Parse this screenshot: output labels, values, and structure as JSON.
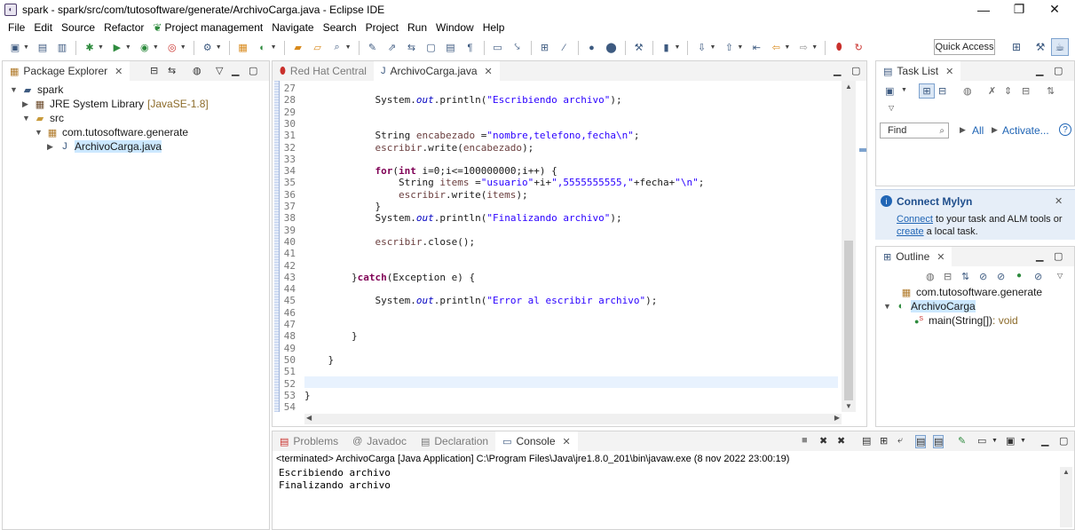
{
  "window": {
    "title": "spark - spark/src/com/tutosoftware/generate/ArchivoCarga.java - Eclipse IDE",
    "minimize": "—",
    "restore": "❐",
    "close": "✕"
  },
  "menu": [
    "File",
    "Edit",
    "Source",
    "Refactor",
    "Project management",
    "Navigate",
    "Search",
    "Project",
    "Run",
    "Window",
    "Help"
  ],
  "toolbar": {
    "quick_access": "Quick Access"
  },
  "package_explorer": {
    "tab_label": "Package Explorer",
    "tree": [
      {
        "label": "spark",
        "extra": ""
      },
      {
        "label": "JRE System Library",
        "extra": "[JavaSE-1.8]"
      },
      {
        "label": "src",
        "extra": ""
      },
      {
        "label": "com.tutosoftware.generate",
        "extra": ""
      },
      {
        "label": "ArchivoCarga.java",
        "extra": ""
      }
    ]
  },
  "editor": {
    "tabs": [
      {
        "label": "Red Hat Central"
      },
      {
        "label": "ArchivoCarga.java"
      }
    ],
    "lines": [
      {
        "n": "27",
        "code": ""
      },
      {
        "n": "28",
        "code": "            System.out.println(\"Escribiendo archivo\");"
      },
      {
        "n": "29",
        "code": ""
      },
      {
        "n": "30",
        "code": ""
      },
      {
        "n": "31",
        "code": "            String encabezado =\"nombre,telefono,fecha\\n\";"
      },
      {
        "n": "32",
        "code": "            escribir.write(encabezado);"
      },
      {
        "n": "33",
        "code": ""
      },
      {
        "n": "34",
        "code": "            for(int i=0;i<=100000000;i++) {"
      },
      {
        "n": "35",
        "code": "                String items =\"usuario\"+i+\",5555555555,\"+fecha+\"\\n\";"
      },
      {
        "n": "36",
        "code": "                escribir.write(items);"
      },
      {
        "n": "37",
        "code": "            }"
      },
      {
        "n": "38",
        "code": "            System.out.println(\"Finalizando archivo\");"
      },
      {
        "n": "39",
        "code": ""
      },
      {
        "n": "40",
        "code": "            escribir.close();"
      },
      {
        "n": "41",
        "code": ""
      },
      {
        "n": "42",
        "code": ""
      },
      {
        "n": "43",
        "code": "        }catch(Exception e) {"
      },
      {
        "n": "44",
        "code": ""
      },
      {
        "n": "45",
        "code": "            System.out.println(\"Error al escribir archivo\");"
      },
      {
        "n": "46",
        "code": ""
      },
      {
        "n": "47",
        "code": ""
      },
      {
        "n": "48",
        "code": "        }"
      },
      {
        "n": "49",
        "code": ""
      },
      {
        "n": "50",
        "code": "    }"
      },
      {
        "n": "51",
        "code": ""
      },
      {
        "n": "52",
        "code": ""
      },
      {
        "n": "53",
        "code": "}"
      },
      {
        "n": "54",
        "code": ""
      }
    ]
  },
  "task_list": {
    "tab_label": "Task List",
    "find_placeholder": "Find",
    "all_label": "All",
    "activate_label": "Activate..."
  },
  "mylyn": {
    "title": "Connect Mylyn",
    "connect_link": "Connect",
    "text1": " to your task and ALM tools or",
    "create_link": "create",
    "text2": " a local task."
  },
  "outline": {
    "tab_label": "Outline",
    "items": [
      {
        "label": "com.tutosoftware.generate",
        "extra": ""
      },
      {
        "label": "ArchivoCarga",
        "extra": ""
      },
      {
        "label": "main(String[])",
        "extra": " : void"
      }
    ]
  },
  "bottom": {
    "tabs": [
      {
        "label": "Problems"
      },
      {
        "label": "Javadoc"
      },
      {
        "label": "Declaration"
      },
      {
        "label": "Console"
      }
    ],
    "terminated": "<terminated> ArchivoCarga [Java Application] C:\\Program Files\\Java\\jre1.8.0_201\\bin\\javaw.exe (8 nov 2022 23:00:19)",
    "output": [
      "Escribiendo archivo",
      "Finalizando archivo"
    ]
  }
}
